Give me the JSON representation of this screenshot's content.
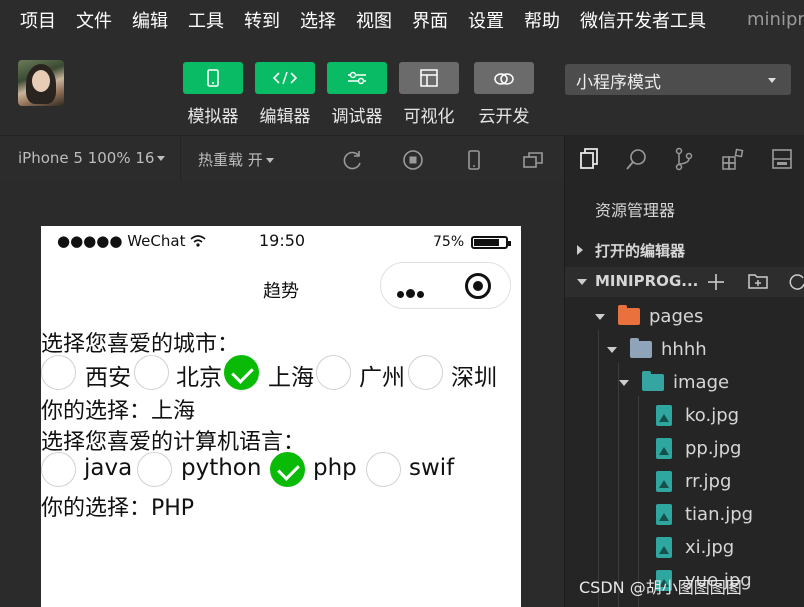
{
  "menu": [
    "项目",
    "文件",
    "编辑",
    "工具",
    "转到",
    "选择",
    "视图",
    "界面",
    "设置",
    "帮助",
    "微信开发者工具"
  ],
  "app_name": "minipro",
  "toolbar": {
    "buttons": [
      {
        "label": "模拟器",
        "icon": "phone-icon",
        "color": "#09bb64"
      },
      {
        "label": "编辑器",
        "icon": "code-icon",
        "color": "#09bb64"
      },
      {
        "label": "调试器",
        "icon": "sliders-icon",
        "color": "#09bb64"
      },
      {
        "label": "可视化",
        "icon": "layout-icon",
        "color": "#6b6b6b"
      },
      {
        "label": "云开发",
        "icon": "cloud-icon",
        "color": "#6b6b6b"
      }
    ],
    "mode": "小程序模式"
  },
  "simbar": {
    "device": "iPhone 5 100% 16",
    "hot_reload": "热重载 开"
  },
  "phone": {
    "carrier": "●●●●● WeChat",
    "time": "19:50",
    "battery": "75%",
    "battery_level": 0.75,
    "nav_title": "趋势"
  },
  "content": {
    "city_prompt": "选择您喜爱的城市：",
    "cities": [
      {
        "label": "西安",
        "checked": false
      },
      {
        "label": "北京",
        "checked": false
      },
      {
        "label": "上海",
        "checked": true
      },
      {
        "label": "广州",
        "checked": false
      },
      {
        "label": "深圳",
        "checked": false
      }
    ],
    "city_choice": "你的选择：上海",
    "lang_prompt": "选择您喜爱的计算机语言：",
    "langs": [
      {
        "label": "java",
        "checked": false
      },
      {
        "label": "python",
        "checked": false
      },
      {
        "label": "php",
        "checked": true
      },
      {
        "label": "swif",
        "checked": false
      }
    ],
    "lang_choice": "你的选择：PHP"
  },
  "explorer": {
    "title": "资源管理器",
    "open_editors": "打开的编辑器",
    "project": "MINIPROG...",
    "tree": [
      {
        "label": "pages",
        "type": "folder"
      },
      {
        "label": "hhhh",
        "type": "folder"
      },
      {
        "label": "image",
        "type": "folder"
      },
      {
        "label": "ko.jpg",
        "type": "image"
      },
      {
        "label": "pp.jpg",
        "type": "image"
      },
      {
        "label": "rr.jpg",
        "type": "image"
      },
      {
        "label": "tian.jpg",
        "type": "image"
      },
      {
        "label": "xi.jpg",
        "type": "image"
      },
      {
        "label": "yue.jpg",
        "type": "image"
      }
    ]
  },
  "watermark": "CSDN @胡小图图图图"
}
